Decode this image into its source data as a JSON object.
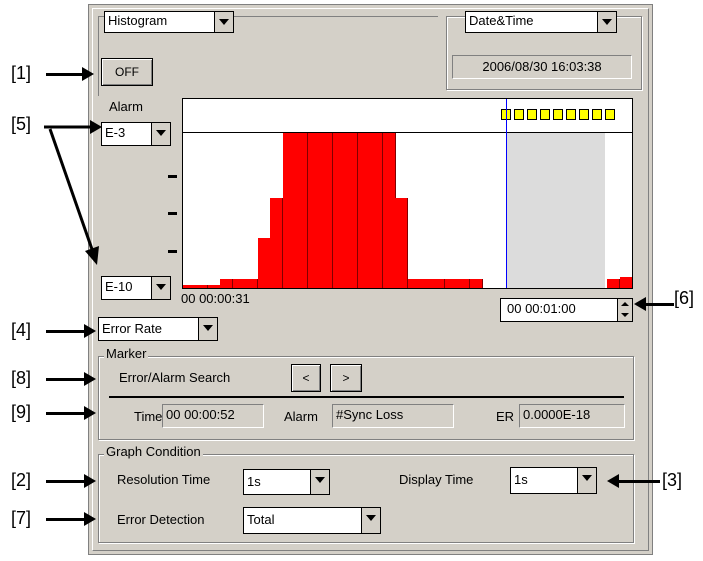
{
  "top": {
    "mode_select": "Histogram",
    "clock_select": "Date&Time",
    "datetime": "2006/08/30 16:03:38",
    "off_button": "OFF"
  },
  "alarm": {
    "label": "Alarm",
    "upper_select": "E-3",
    "lower_select": "E-10"
  },
  "graph": {
    "start_time": "00 00:00:31",
    "span_value": "00 00:01:00",
    "cursor_fraction": 0.72,
    "bars": [
      0.02,
      0.02,
      0.02,
      0.06,
      0.06,
      0.06,
      0.32,
      0.58,
      1,
      1,
      1,
      1,
      1,
      1,
      1,
      1,
      1,
      0.58,
      0.06,
      0.06,
      0.06,
      0.06,
      0.06,
      0.06,
      0,
      0,
      0,
      0,
      0,
      0,
      0,
      0,
      0,
      0,
      0.06,
      0.07
    ],
    "alarm_markers": 9,
    "colors": {
      "bar": "#ff0000",
      "marker": "#ffff00",
      "cursor": "#0000ff",
      "shade": "#dcdcdc"
    }
  },
  "measure_select": "Error Rate",
  "marker": {
    "group_label": "Marker",
    "search_label": "Error/Alarm Search",
    "prev_button": "<",
    "next_button": ">",
    "time_label": "Time",
    "time_value": "00 00:00:52",
    "alarm_label": "Alarm",
    "alarm_value": "#Sync Loss",
    "er_label": "ER",
    "er_value": "0.0000E-18"
  },
  "condition": {
    "group_label": "Graph Condition",
    "resolution_label": "Resolution Time",
    "resolution_value": "1s",
    "display_label": "Display Time",
    "display_value": "1s",
    "detection_label": "Error Detection",
    "detection_value": "Total"
  },
  "callouts": {
    "c1": "[1]",
    "c2": "[2]",
    "c3": "[3]",
    "c4": "[4]",
    "c5": "[5]",
    "c6": "[6]",
    "c7": "[7]",
    "c8": "[8]",
    "c9": "[9]"
  }
}
